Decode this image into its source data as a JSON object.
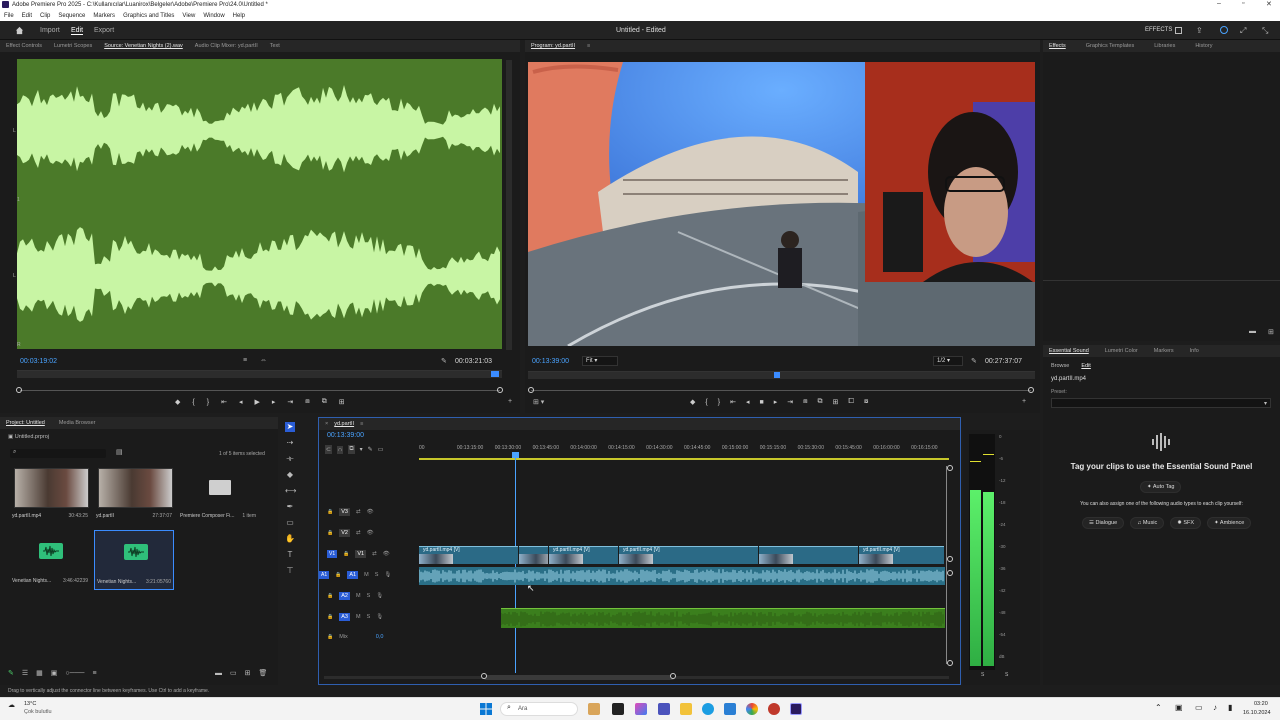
{
  "window": {
    "title": "Adobe Premiere Pro 2025 - C:\\Kullanıcılar\\Luanirox\\Belgeler\\Adobe\\Premiere Pro\\24.0\\Untitled *"
  },
  "menu": [
    "File",
    "Edit",
    "Clip",
    "Sequence",
    "Markers",
    "Graphics and Titles",
    "View",
    "Window",
    "Help"
  ],
  "workspace": {
    "home_icon": "home-icon",
    "tabs": [
      "Import",
      "Edit",
      "Export"
    ],
    "active_tab": "Edit",
    "doc_title": "Untitled - Edited",
    "effects_label": "EFFECTS"
  },
  "source_panel": {
    "tabs": [
      "Effect Controls",
      "Lumetri Scopes",
      "Source: Venetian Nights (2).wav",
      "Audio Clip Mixer: yd.partII",
      "Text"
    ],
    "active_tab": "Source: Venetian Nights (2).wav",
    "timecode": "00:03:19:02",
    "duration": "00:03:21:03",
    "waveform_color": "#c8f5a4",
    "bg_color": "#4b7a29",
    "channel_marks": [
      "L",
      "1",
      "L",
      "R"
    ]
  },
  "program_panel": {
    "tab": "Program: yd.partII",
    "timecode": "00:13:39:00",
    "fit": "Fit",
    "resolution": "1/2",
    "duration": "00:27:37:07"
  },
  "right_top_tabs": [
    "Effects",
    "Graphics Templates",
    "Libraries",
    "History"
  ],
  "essential_sound": {
    "tabs": [
      "Essential Sound",
      "Lumetri Color",
      "Markers",
      "Info"
    ],
    "subtabs": [
      "Browse",
      "Edit"
    ],
    "clip": "yd.partII.mp4",
    "preset_label": "Preset:",
    "headline": "Tag your clips to use the Essential Sound Panel",
    "auto_tag": "Auto Tag",
    "help": "You can also assign one of the following audio types to each clip yourself:",
    "types": [
      "Dialogue",
      "Music",
      "SFX",
      "Ambience"
    ]
  },
  "project_panel": {
    "tabs": [
      "Project: Untitled",
      "Media Browser"
    ],
    "project_file": "Untitled.prproj",
    "selection_info": "1 of 5 items selected",
    "items": [
      {
        "name": "yd.partII.mp4",
        "duration": "30:43:25",
        "kind": "video"
      },
      {
        "name": "yd.partII",
        "duration": "27:37:07",
        "kind": "video"
      },
      {
        "name": "Premiere Composer Fi...",
        "duration": "1 item",
        "kind": "folder"
      },
      {
        "name": "Venetian Nights...",
        "duration": "3:46:42239",
        "kind": "audio"
      },
      {
        "name": "Venetian Nights...",
        "duration": "3:21:05760",
        "kind": "audio",
        "selected": true
      }
    ]
  },
  "timeline": {
    "sequence_tab": "yd.partII",
    "timecode": "00:13:39:00",
    "ruler": [
      "00",
      "00:13:15:00",
      "00:13:30:00",
      "00:13:45:00",
      "00:14:00:00",
      "00:14:15:00",
      "00:14:30:00",
      "00:14:45:00",
      "00:15:00:00",
      "00:15:15:00",
      "00:15:30:00",
      "00:15:45:00",
      "00:16:00:00",
      "00:16:15:00"
    ],
    "tracks": [
      "V3",
      "V2",
      "V1",
      "A1",
      "A2",
      "A3",
      "Mix"
    ],
    "mix_value": "0,0",
    "video_clips": [
      "yd.partII.mp4 [V]",
      "yd.partII.mp4 [V]",
      "yd.partII.mp4 [V]",
      "yd.partII.mp4 [V]"
    ]
  },
  "meter_scale": [
    "0",
    "-6",
    "-12",
    "-18",
    "-24",
    "-30",
    "-36",
    "-42",
    "-48",
    "-54",
    "dB"
  ],
  "status_hint": "Drag to vertically adjust the connector line between keyframes. Use Ctrl to add a keyframe.",
  "taskbar": {
    "weather_temp": "13°C",
    "weather_desc": "Çok bulutlu",
    "search": "Ara",
    "time": "03:20",
    "date": "16.10.2024"
  }
}
